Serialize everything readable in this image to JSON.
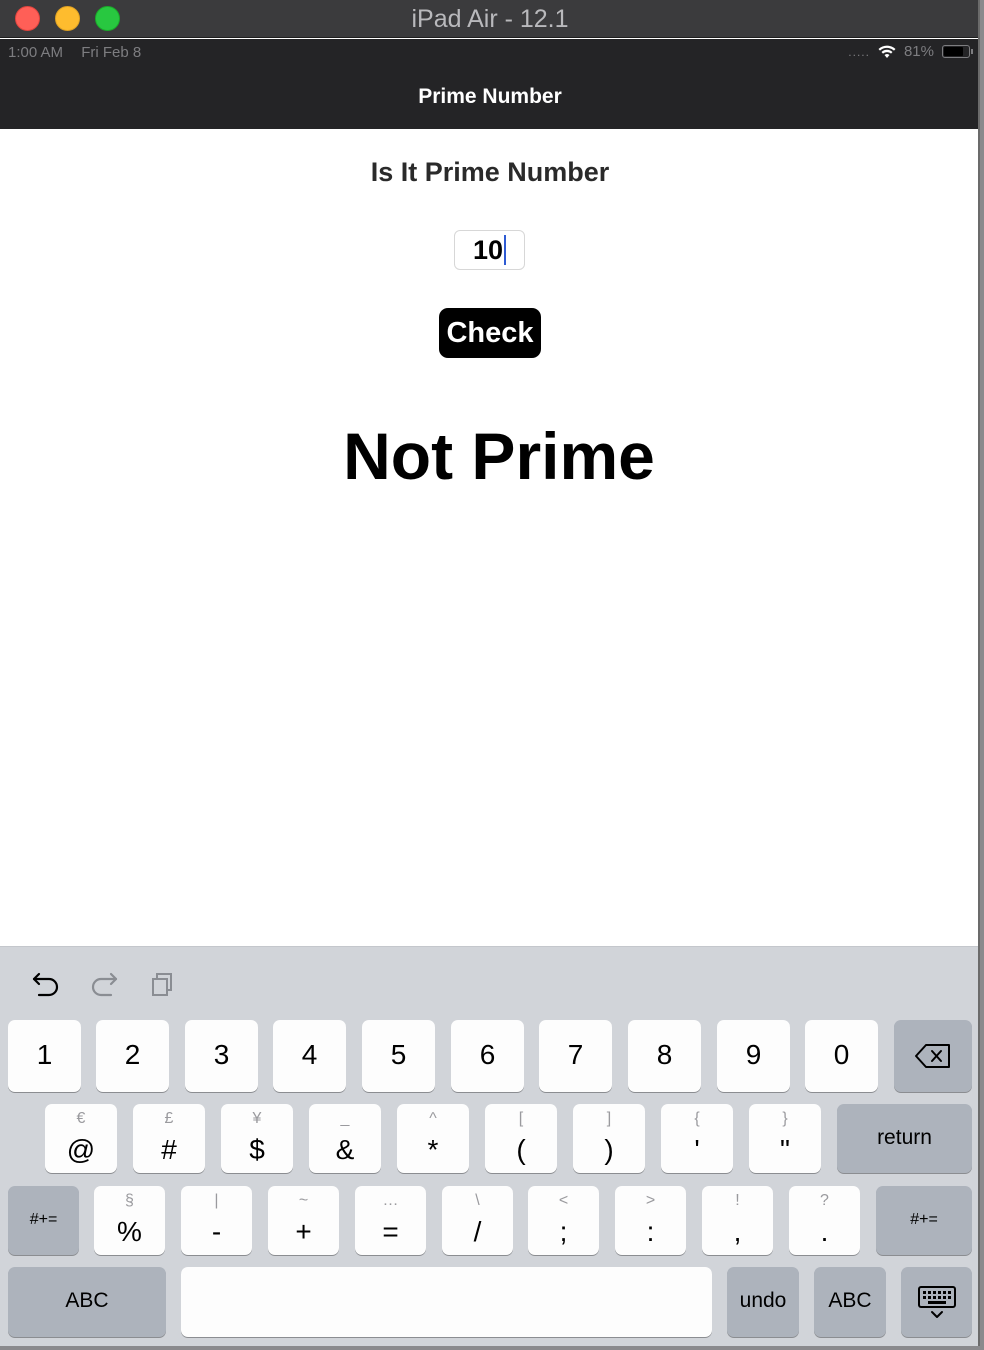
{
  "window": {
    "title": "iPad Air - 12.1"
  },
  "status": {
    "time": "1:00 AM",
    "date": "Fri Feb 8",
    "battery": "81%",
    "battery_level": 0.81
  },
  "nav": {
    "title": "Prime Number"
  },
  "main": {
    "heading": "Is It Prime Number",
    "input_value": "10",
    "check_label": "Check",
    "result": "Not Prime"
  },
  "keyboard": {
    "toolbar": [
      "undo-icon",
      "redo-icon",
      "paste-icon"
    ],
    "row1": [
      "1",
      "2",
      "3",
      "4",
      "5",
      "6",
      "7",
      "8",
      "9",
      "0"
    ],
    "row2": [
      {
        "main": "@",
        "sub": "€"
      },
      {
        "main": "#",
        "sub": "£"
      },
      {
        "main": "$",
        "sub": "¥"
      },
      {
        "main": "&",
        "sub": "_"
      },
      {
        "main": "*",
        "sub": "^"
      },
      {
        "main": "(",
        "sub": "["
      },
      {
        "main": ")",
        "sub": "]"
      },
      {
        "main": "'",
        "sub": "{"
      },
      {
        "main": "\"",
        "sub": "}"
      }
    ],
    "return_label": "return",
    "shift_label": "#+=",
    "row3": [
      {
        "main": "%",
        "sub": "§"
      },
      {
        "main": "-",
        "sub": "|"
      },
      {
        "main": "+",
        "sub": "~"
      },
      {
        "main": "=",
        "sub": "…"
      },
      {
        "main": "/",
        "sub": "\\"
      },
      {
        "main": ";",
        "sub": "<"
      },
      {
        "main": ":",
        "sub": ">"
      },
      {
        "main": ",",
        "sub": "!"
      },
      {
        "main": ".",
        "sub": "?"
      }
    ],
    "abc_label": "ABC",
    "undo_label": "undo",
    "dismiss_icon": "keyboard-dismiss-icon"
  }
}
